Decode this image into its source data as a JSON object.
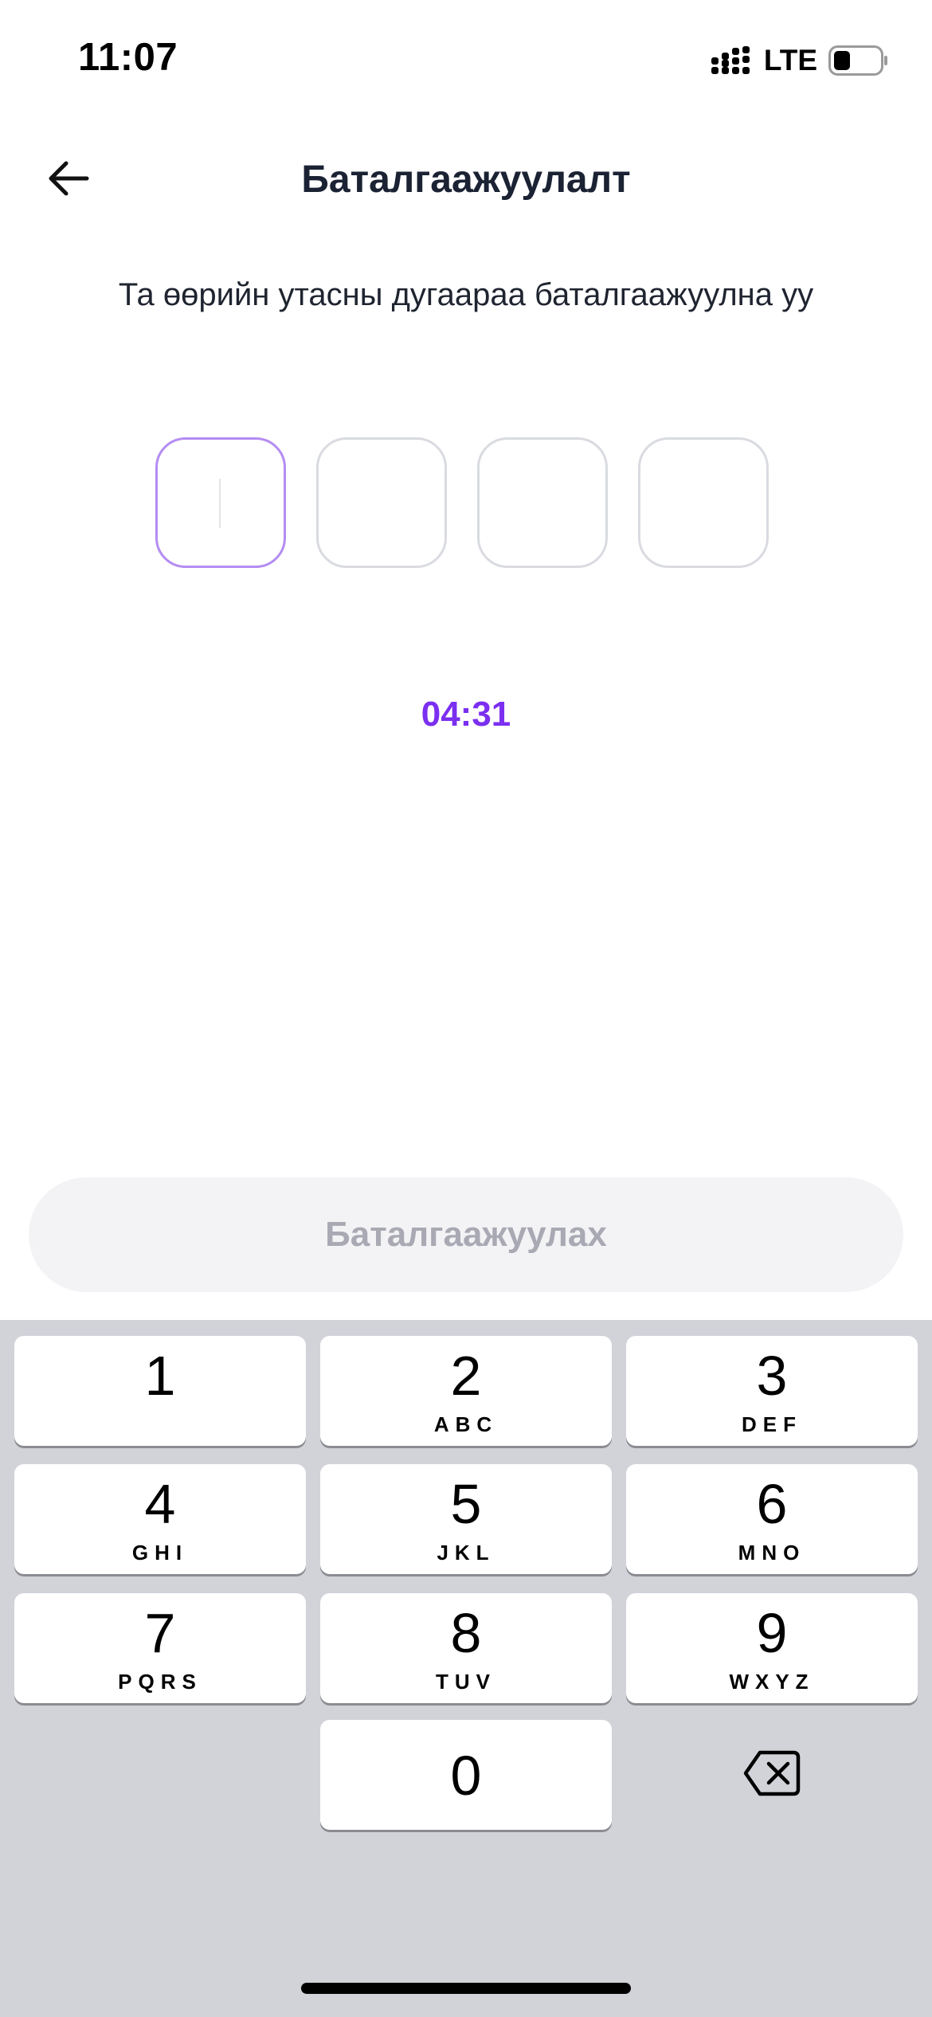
{
  "status_bar": {
    "time": "11:07",
    "network": "LTE",
    "battery_level": 0.35
  },
  "header": {
    "title": "Баталгаажуулалт",
    "back_icon": "arrow-left-icon"
  },
  "instruction": "Та өөрийн утасны дугаараа баталгаажуулна уу",
  "otp": {
    "length": 4,
    "values": [
      "",
      "",
      "",
      ""
    ],
    "active_index": 0
  },
  "timer": "04:31",
  "confirm_button": {
    "label": "Баталгаажуулах",
    "enabled": false
  },
  "keyboard": {
    "keys": [
      {
        "digit": "1",
        "letters": ""
      },
      {
        "digit": "2",
        "letters": "ABC"
      },
      {
        "digit": "3",
        "letters": "DEF"
      },
      {
        "digit": "4",
        "letters": "GHI"
      },
      {
        "digit": "5",
        "letters": "JKL"
      },
      {
        "digit": "6",
        "letters": "MNO"
      },
      {
        "digit": "7",
        "letters": "PQRS"
      },
      {
        "digit": "8",
        "letters": "TUV"
      },
      {
        "digit": "9",
        "letters": "WXYZ"
      },
      {
        "digit": "0",
        "letters": ""
      }
    ],
    "delete_icon": "backspace-icon"
  },
  "colors": {
    "accent": "#7b2ff0",
    "active_border": "#b48cf2",
    "disabled_button_bg": "#f3f3f6",
    "disabled_button_text": "#a9a9b4",
    "keyboard_bg": "#d1d3d9"
  }
}
